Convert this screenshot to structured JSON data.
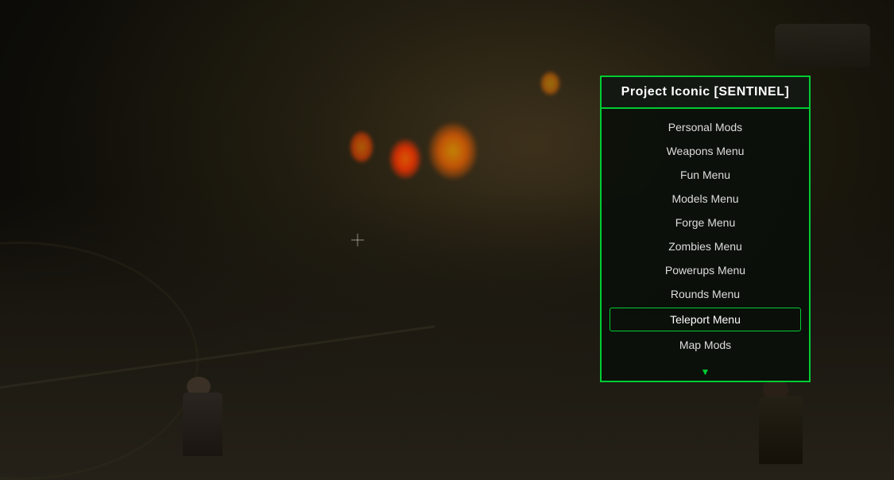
{
  "menu": {
    "title": "Project Iconic [SENTINEL]",
    "items": [
      {
        "label": "Personal Mods",
        "active": false
      },
      {
        "label": "Weapons Menu",
        "active": false
      },
      {
        "label": "Fun Menu",
        "active": false
      },
      {
        "label": "Models Menu",
        "active": false
      },
      {
        "label": "Forge Menu",
        "active": false
      },
      {
        "label": "Zombies Menu",
        "active": false
      },
      {
        "label": "Powerups Menu",
        "active": false
      },
      {
        "label": "Rounds Menu",
        "active": false
      },
      {
        "label": "Teleport Menu",
        "active": true
      },
      {
        "label": "Map Mods",
        "active": false
      }
    ],
    "scroll_indicator": "▼"
  },
  "colors": {
    "border": "#00cc33",
    "active_bg": "transparent",
    "title_color": "#ffffff",
    "item_color": "#dddddd",
    "active_item_color": "#ffffff"
  }
}
